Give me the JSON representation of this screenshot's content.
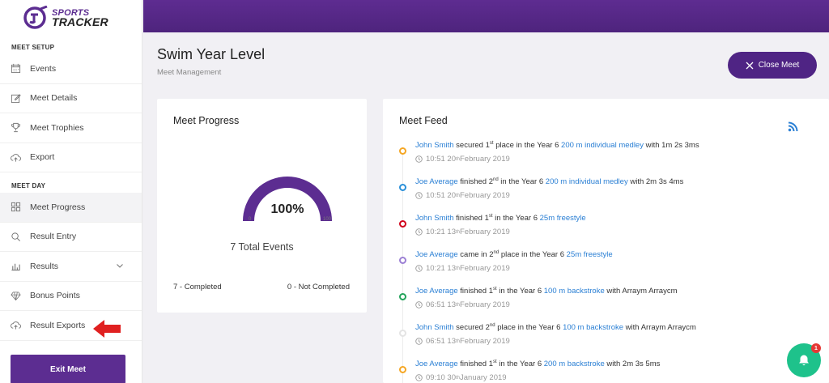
{
  "app": {
    "logo_line1": "SPORTS",
    "logo_line2": "TRACKER",
    "brand_color": "#5c2d91"
  },
  "sidebar": {
    "section_meet_setup": "MEET SETUP",
    "setup_items": [
      {
        "label": "Events",
        "icon": "calendar-icon"
      },
      {
        "label": "Meet Details",
        "icon": "edit-icon"
      },
      {
        "label": "Meet Trophies",
        "icon": "trophy-icon"
      },
      {
        "label": "Export",
        "icon": "cloud-upload-icon"
      }
    ],
    "section_meet_day": "MEET DAY",
    "day_items": [
      {
        "label": "Meet Progress",
        "icon": "grid-icon",
        "active": true
      },
      {
        "label": "Result Entry",
        "icon": "search-icon"
      },
      {
        "label": "Results",
        "icon": "bar-chart-icon",
        "expandable": true
      },
      {
        "label": "Bonus Points",
        "icon": "diamond-icon"
      },
      {
        "label": "Result Exports",
        "icon": "cloud-upload-icon"
      }
    ],
    "exit_label": "Exit Meet"
  },
  "header": {
    "title": "Swim Year Level",
    "breadcrumb": "Meet Management",
    "close_label": "Close Meet"
  },
  "progress": {
    "title": "Meet Progress",
    "percent_label": "100%",
    "percent_value": 100,
    "gauge_min": "0",
    "gauge_max": "100",
    "total_events": "7 Total Events",
    "completed": "7 - Completed",
    "not_completed": "0 - Not Completed"
  },
  "feed": {
    "title": "Meet Feed",
    "items": [
      {
        "dot_color": "#f5a623",
        "name": "John Smith",
        "verb": " secured ",
        "place": "1",
        "place_sup": "st",
        "mid": " place in the Year 6 ",
        "event": "200 m individual medley",
        "tail": " with 1m 2s 3ms",
        "time": "10:51 20",
        "time_sup": "th",
        "date": " February 2019"
      },
      {
        "dot_color": "#2a8fd8",
        "name": "Joe Average",
        "verb": " finished ",
        "place": "2",
        "place_sup": "nd",
        "mid": " in the Year 6 ",
        "event": "200 m individual medley",
        "tail": " with 2m 3s 4ms",
        "time": "10:51 20",
        "time_sup": "th",
        "date": " February 2019"
      },
      {
        "dot_color": "#d0021b",
        "name": "John Smith",
        "verb": " finished ",
        "place": "1",
        "place_sup": "st",
        "mid": " in the Year 6 ",
        "event": "25m freestyle",
        "tail": "",
        "time": "10:21 13",
        "time_sup": "th",
        "date": " February 2019"
      },
      {
        "dot_color": "#9b7fd4",
        "name": "Joe Average",
        "verb": " came in ",
        "place": "2",
        "place_sup": "nd",
        "mid": " place in the Year 6 ",
        "event": "25m freestyle",
        "tail": "",
        "time": "10:21 13",
        "time_sup": "th",
        "date": " February 2019"
      },
      {
        "dot_color": "#22a35a",
        "name": "Joe Average",
        "verb": " finished ",
        "place": "1",
        "place_sup": "st",
        "mid": " in the Year 6 ",
        "event": "100 m backstroke",
        "tail": " with Arraym Arraycm",
        "time": "06:51 13",
        "time_sup": "th",
        "date": " February 2019"
      },
      {
        "dot_color": "#e4e4e4",
        "name": "John Smith",
        "verb": " secured ",
        "place": "2",
        "place_sup": "nd",
        "mid": " place in the Year 6 ",
        "event": "100 m backstroke",
        "tail": " with Arraym Arraycm",
        "time": "06:51 13",
        "time_sup": "th",
        "date": " February 2019"
      },
      {
        "dot_color": "#f5a623",
        "name": "Joe Average",
        "verb": " finished ",
        "place": "1",
        "place_sup": "st",
        "mid": " in the Year 6 ",
        "event": "200 m backstroke",
        "tail": " with 2m 3s 5ms",
        "time": "09:10 30",
        "time_sup": "th",
        "date": " January 2019"
      }
    ]
  },
  "notifications": {
    "count": "1"
  }
}
